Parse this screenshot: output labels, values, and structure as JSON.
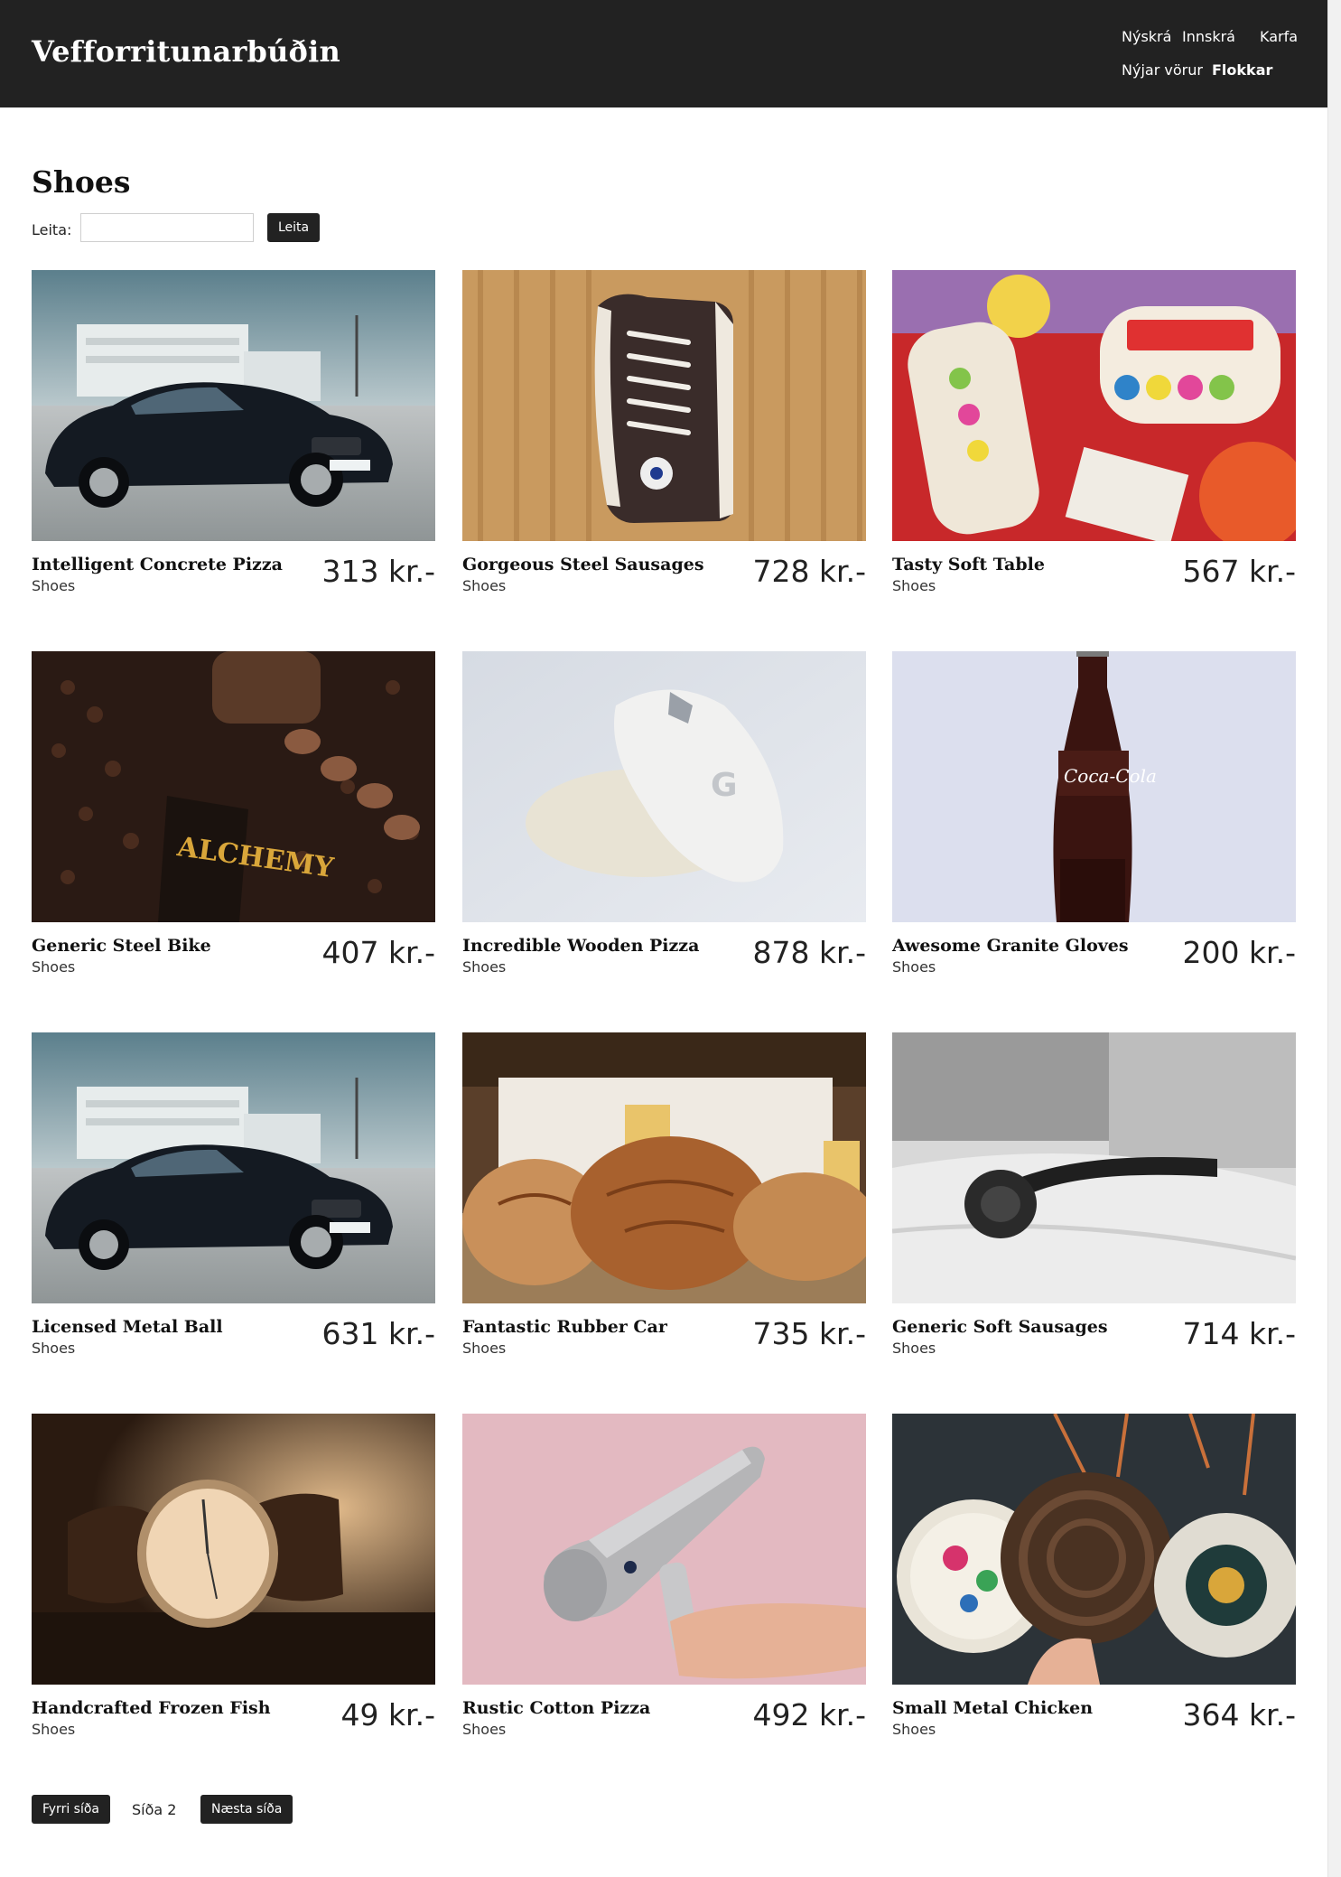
{
  "header": {
    "brand": "Vefforritunarbúðin",
    "nav": {
      "signup": "Nýskrá",
      "login": "Innskrá",
      "cart": "Karfa",
      "new_products": "Nýjar vörur",
      "categories": "Flokkar"
    }
  },
  "main": {
    "title": "Shoes",
    "search": {
      "label": "Leita:",
      "value": "",
      "button": "Leita"
    },
    "products": [
      {
        "name": "Intelligent Concrete Pizza",
        "category": "Shoes",
        "price": "313 kr.-",
        "image": "black-car"
      },
      {
        "name": "Gorgeous Steel Sausages",
        "category": "Shoes",
        "price": "728 kr.-",
        "image": "sneaker-on-wood"
      },
      {
        "name": "Tasty Soft Table",
        "category": "Shoes",
        "price": "567 kr.-",
        "image": "love-hearts-candy"
      },
      {
        "name": "Generic Steel Bike",
        "category": "Shoes",
        "price": "407 kr.-",
        "image": "coffee-beans"
      },
      {
        "name": "Incredible Wooden Pizza",
        "category": "Shoes",
        "price": "878 kr.-",
        "image": "white-mouse"
      },
      {
        "name": "Awesome Granite Gloves",
        "category": "Shoes",
        "price": "200 kr.-",
        "image": "cola-bottle"
      },
      {
        "name": "Licensed Metal Ball",
        "category": "Shoes",
        "price": "631 kr.-",
        "image": "black-car"
      },
      {
        "name": "Fantastic Rubber Car",
        "category": "Shoes",
        "price": "735 kr.-",
        "image": "bread-loaves"
      },
      {
        "name": "Generic Soft Sausages",
        "category": "Shoes",
        "price": "714 kr.-",
        "image": "headphones-on-bed"
      },
      {
        "name": "Handcrafted Frozen Fish",
        "category": "Shoes",
        "price": "49 kr.-",
        "image": "wrist-watch"
      },
      {
        "name": "Rustic Cotton Pizza",
        "category": "Shoes",
        "price": "492 kr.-",
        "image": "hair-dryer"
      },
      {
        "name": "Small Metal Chicken",
        "category": "Shoes",
        "price": "364 kr.-",
        "image": "woven-bags"
      }
    ],
    "pagination": {
      "prev": "Fyrri síða",
      "current": "Síða 2",
      "next": "Næsta síða"
    }
  },
  "colors": {
    "header_bg": "#222222",
    "button_bg": "#222222",
    "text": "#222222"
  }
}
